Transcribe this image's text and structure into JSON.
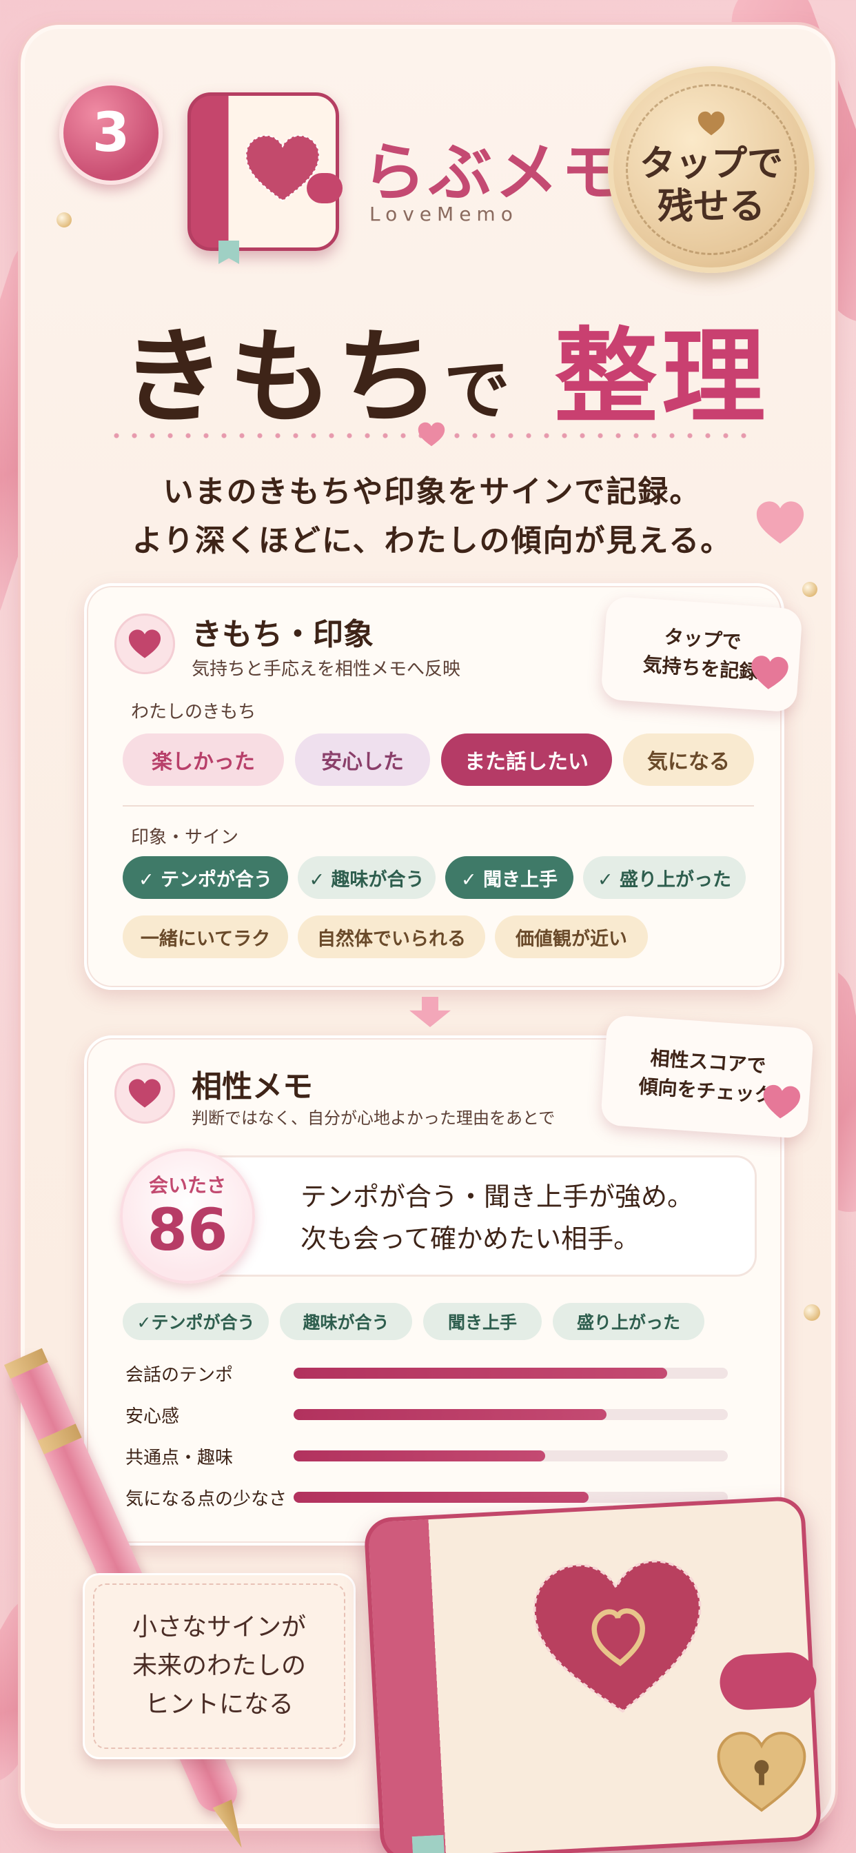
{
  "step_number": "3",
  "app": {
    "name": "らぶメモ",
    "subtitle": "LoveMemo"
  },
  "seal": {
    "text_line1": "タップで",
    "text_line2": "残せる"
  },
  "headline": {
    "part1": "きもち",
    "part2": "で",
    "part3": "整理"
  },
  "description": {
    "line1": "いまのきもちや印象をサインで記録。",
    "line2": "より深くほどに、わたしの傾向が見える。"
  },
  "card1": {
    "title": "きもち・印象",
    "subtitle": "気持ちと手応えを相性メモへ反映",
    "feelings_label": "わたしのきもち",
    "feelings": [
      "楽しかった",
      "安心した",
      "また話したい",
      "気になる"
    ],
    "impressions_label": "印象・サイン",
    "signs_selected": [
      "✓ テンポが合う",
      "✓ 趣味が合う",
      "✓ 聞き上手",
      "✓ 盛り上がった"
    ],
    "signs_other": [
      "一緒にいてラク",
      "自然体でいられる",
      "価値観が近い"
    ],
    "note": {
      "line1": "タップで",
      "line2": "気持ちを記録"
    }
  },
  "card2": {
    "title": "相性メモ",
    "subtitle": "判断ではなく、自分が心地よかった理由をあとで",
    "score_label": "会いたさ",
    "score_value": "86",
    "summary_line1": "テンポが合う・聞き上手が強め。",
    "summary_line2": "次も会って確かめたい相手。",
    "tags": [
      "✓テンポが合う",
      "趣味が合う",
      "聞き上手",
      "盛り上がった"
    ],
    "metrics": [
      {
        "label": "会話のテンポ",
        "value": 0.86
      },
      {
        "label": "安心感",
        "value": 0.72
      },
      {
        "label": "共通点・趣味",
        "value": 0.58
      },
      {
        "label": "気になる点の少なさ",
        "value": 0.68
      }
    ],
    "note": {
      "line1": "相性スコアで",
      "line2": "傾向をチェック"
    }
  },
  "hint": {
    "line1": "小さなサインが",
    "line2": "未来のわたしの",
    "line3": "ヒントになる"
  },
  "colors": {
    "accent": "#c44a72",
    "dark_text": "#3e2418",
    "chip_selected": "#3f7a68",
    "chip_pink": "#f8dde3",
    "chip_lilac": "#efe0ee",
    "chip_cream": "#f9ead0",
    "chip_mint": "#e4ede6"
  }
}
